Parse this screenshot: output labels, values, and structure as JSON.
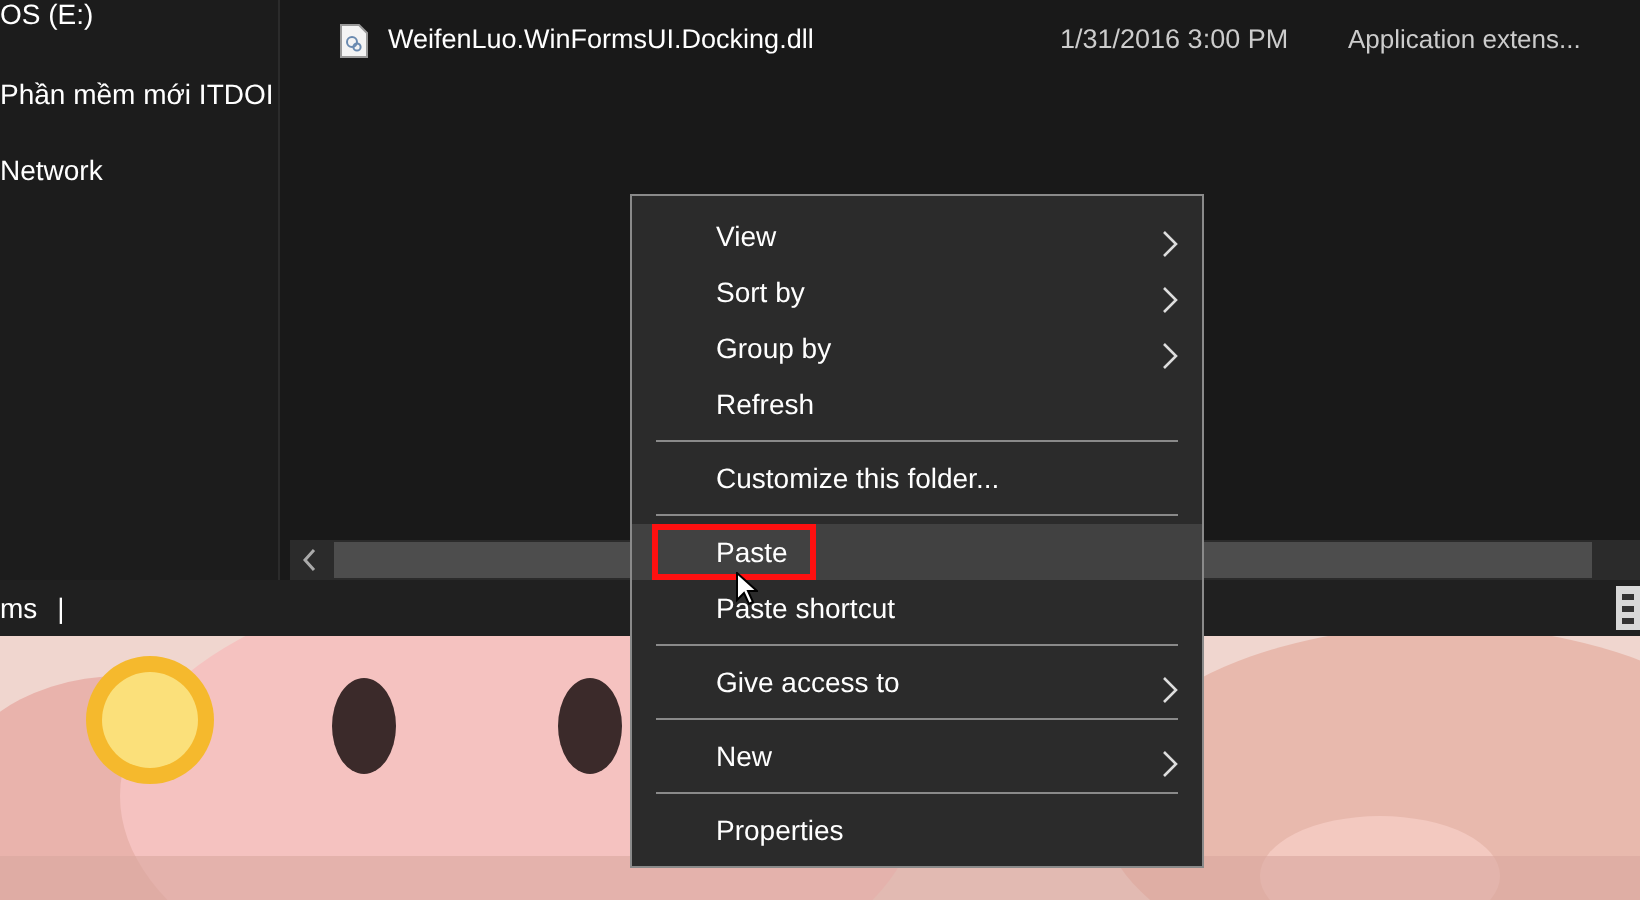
{
  "sidebar": {
    "items": [
      {
        "label": "OS (E:)"
      },
      {
        "label": "Phần mềm mới ITDOI"
      },
      {
        "label": "Network"
      }
    ]
  },
  "files": [
    {
      "name": "WeifenLuo.WinFormsUI.Docking.dll",
      "date": "1/31/2016 3:00 PM",
      "type": "Application extens..."
    }
  ],
  "status_bar": {
    "text": "ms",
    "separator": "|"
  },
  "context_menu": {
    "items": [
      {
        "kind": "item",
        "label": "View",
        "submenu": true,
        "selected": false,
        "boxed": false
      },
      {
        "kind": "item",
        "label": "Sort by",
        "submenu": true,
        "selected": false,
        "boxed": false
      },
      {
        "kind": "item",
        "label": "Group by",
        "submenu": true,
        "selected": false,
        "boxed": false
      },
      {
        "kind": "item",
        "label": "Refresh",
        "submenu": false,
        "selected": false,
        "boxed": false
      },
      {
        "kind": "separator"
      },
      {
        "kind": "item",
        "label": "Customize this folder...",
        "submenu": false,
        "selected": false,
        "boxed": false
      },
      {
        "kind": "separator"
      },
      {
        "kind": "item",
        "label": "Paste",
        "submenu": false,
        "selected": true,
        "boxed": true
      },
      {
        "kind": "item",
        "label": "Paste shortcut",
        "submenu": false,
        "selected": false,
        "boxed": false
      },
      {
        "kind": "separator"
      },
      {
        "kind": "item",
        "label": "Give access to",
        "submenu": true,
        "selected": false,
        "boxed": false
      },
      {
        "kind": "separator"
      },
      {
        "kind": "item",
        "label": "New",
        "submenu": true,
        "selected": false,
        "boxed": false
      },
      {
        "kind": "separator"
      },
      {
        "kind": "item",
        "label": "Properties",
        "submenu": false,
        "selected": false,
        "boxed": false
      }
    ]
  }
}
